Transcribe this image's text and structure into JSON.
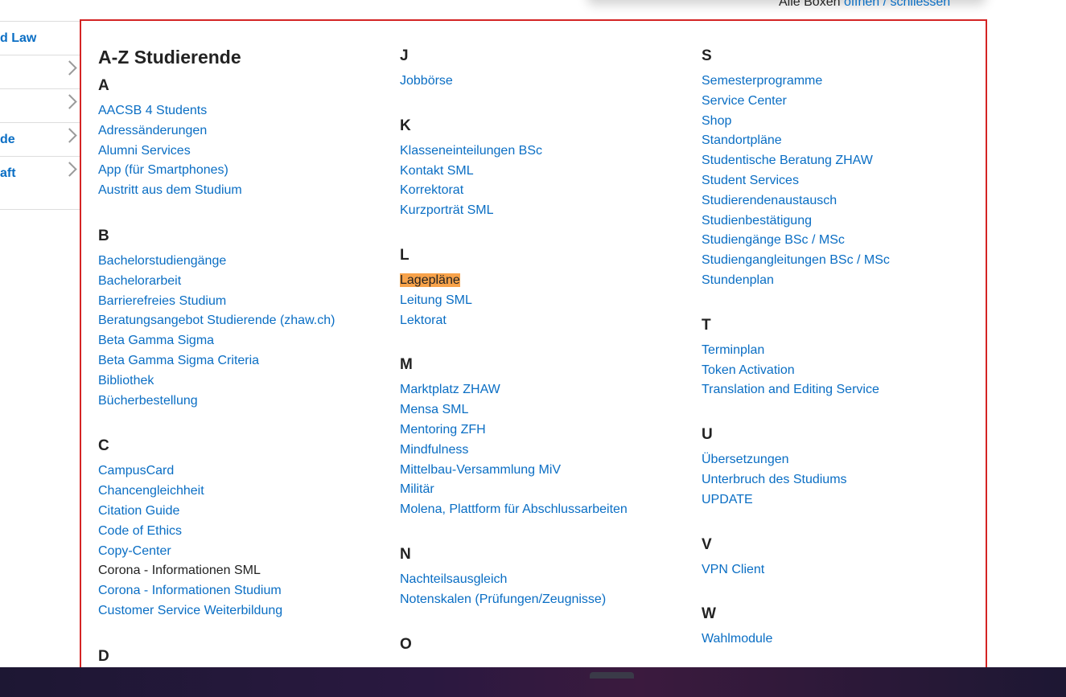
{
  "top_controls": {
    "prefix": "Alle Boxen",
    "open": "öffnen",
    "sep": " / ",
    "close": "schliessen"
  },
  "sidebar": {
    "items": [
      {
        "label": "d Law",
        "chevron": false
      },
      {
        "label": "",
        "chevron": true
      },
      {
        "label": "",
        "chevron": true
      },
      {
        "label": "de",
        "chevron": true
      },
      {
        "label": "aft",
        "chevron": true
      }
    ]
  },
  "title": "A-Z Studierende",
  "groups": {
    "A": {
      "letter": "A",
      "items": [
        "AACSB 4 Students",
        "Adressänderungen",
        "Alumni Services",
        "App (für Smartphones)",
        "Austritt aus dem Studium"
      ]
    },
    "B": {
      "letter": "B",
      "items": [
        "Bachelorstudiengänge",
        "Bachelorarbeit",
        "Barrierefreies Studium",
        "Beratungsangebot Studierende (zhaw.ch)",
        "Beta Gamma Sigma",
        "Beta Gamma Sigma Criteria",
        "Bibliothek",
        "Bücherbestellung"
      ]
    },
    "C": {
      "letter": "C",
      "items": [
        "CampusCard",
        "Chancengleichheit",
        "Citation Guide",
        "Code of Ethics",
        "Copy-Center",
        "Corona - Informationen SML",
        "Corona - Informationen Studium",
        "Customer Service Weiterbildung"
      ]
    },
    "D": {
      "letter": "D",
      "items": []
    },
    "J": {
      "letter": "J",
      "items": [
        "Jobbörse"
      ]
    },
    "K": {
      "letter": "K",
      "items": [
        "Klasseneinteilungen BSc",
        "Kontakt SML",
        "Korrektorat",
        "Kurzporträt SML"
      ]
    },
    "L": {
      "letter": "L",
      "items": [
        "Lagepläne",
        "Leitung SML",
        "Lektorat"
      ]
    },
    "M": {
      "letter": "M",
      "items": [
        "Marktplatz ZHAW",
        "Mensa SML",
        "Mentoring ZFH",
        "Mindfulness",
        "Mittelbau-Versammlung MiV",
        "Militär",
        "Molena, Plattform für Abschlussarbeiten"
      ]
    },
    "N": {
      "letter": "N",
      "items": [
        "Nachteilsausgleich",
        "Notenskalen (Prüfungen/Zeugnisse)"
      ]
    },
    "O": {
      "letter": "O",
      "items": []
    },
    "S": {
      "letter": "S",
      "items": [
        "Semesterprogramme",
        "Service Center",
        "Shop",
        "Standortpläne",
        "Studentische Beratung ZHAW",
        "Student Services",
        "Studierendenaustausch",
        "Studienbestätigung",
        "Studiengänge BSc / MSc",
        "Studiengangleitungen BSc / MSc",
        "Stundenplan"
      ]
    },
    "T": {
      "letter": "T",
      "items": [
        "Terminplan",
        "Token Activation",
        "Translation and Editing Service"
      ]
    },
    "U": {
      "letter": "U",
      "items": [
        "Übersetzungen",
        "Unterbruch des Studiums",
        "UPDATE"
      ]
    },
    "V": {
      "letter": "V",
      "items": [
        "VPN Client"
      ]
    },
    "W": {
      "letter": "W",
      "items": [
        "Wahlmodule"
      ]
    }
  },
  "colors": {
    "link": "#0a6ec4",
    "highlight": "#f7a24a",
    "frame": "#d42424"
  }
}
